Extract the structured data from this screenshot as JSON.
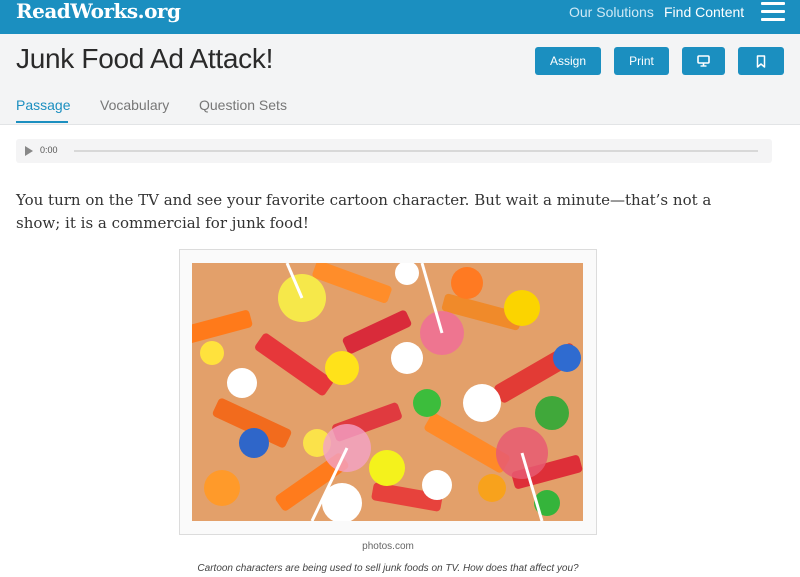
{
  "navbar": {
    "logo": "ReadWorks.org",
    "links": [
      "Our Solutions",
      "Find Content"
    ],
    "menu_icon": "hamburger-icon",
    "color": "#1b8fc0"
  },
  "header": {
    "title": "Junk Food Ad Attack!",
    "buttons": {
      "assign": "Assign",
      "print": "Print",
      "present_icon": "monitor-icon",
      "bookmark_icon": "bookmark-icon"
    },
    "tabs": [
      {
        "label": "Passage",
        "active": true
      },
      {
        "label": "Vocabulary",
        "active": false
      },
      {
        "label": "Question Sets",
        "active": false
      }
    ]
  },
  "audio": {
    "time": "0:00",
    "play_icon": "play-icon"
  },
  "passage": {
    "text": "You turn on the TV and see your favorite cartoon character. But wait a minute—that’s not a show; it is a commercial for junk food!"
  },
  "figure": {
    "image": "candy-photo",
    "credit": "photos.com",
    "caption": "Cartoon characters are being used to sell junk foods on TV. How does that affect you?"
  }
}
